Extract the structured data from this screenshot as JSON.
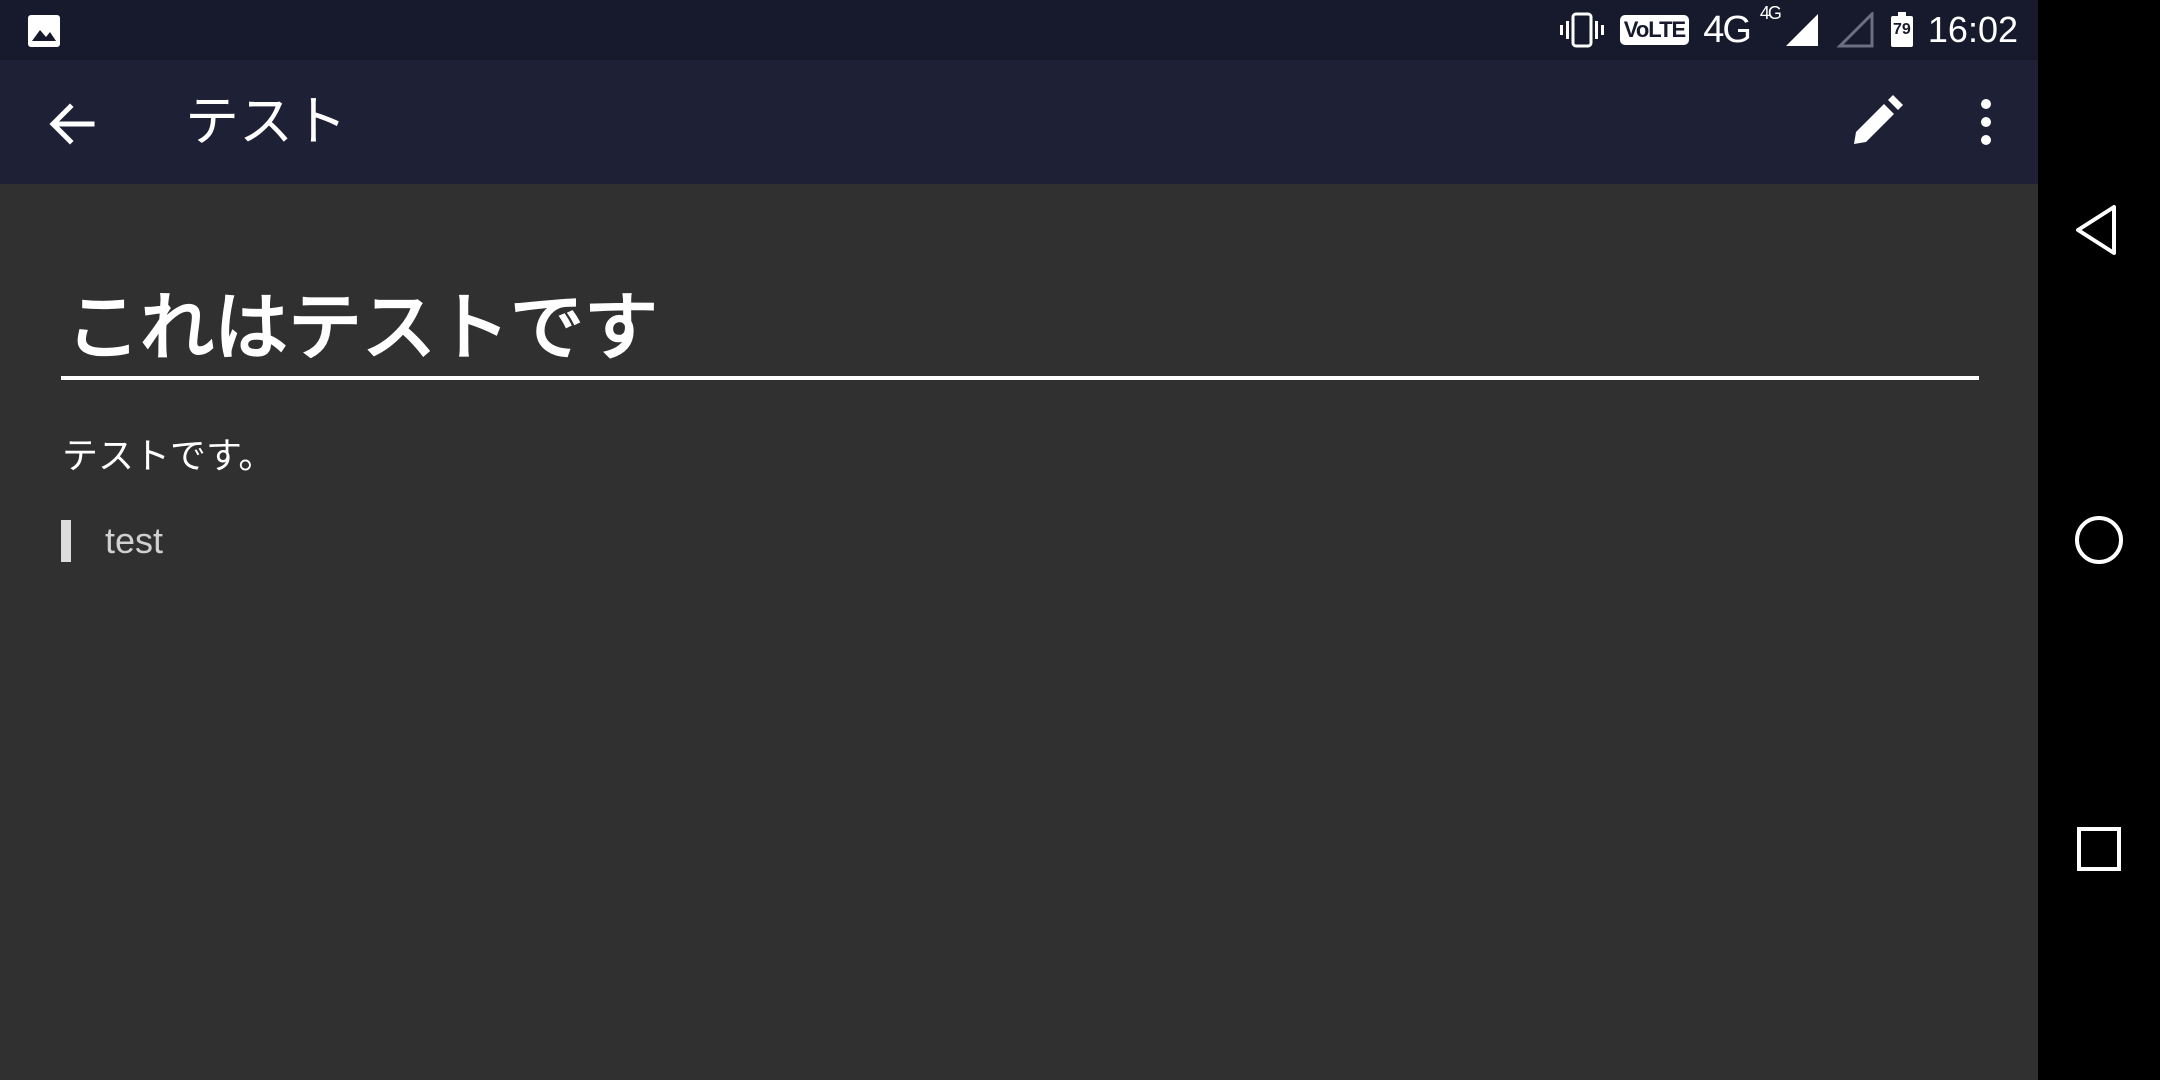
{
  "status_bar": {
    "left_icons": [
      "gallery-icon"
    ],
    "right_icons": [
      "vibrate-icon",
      "volte-icon",
      "signal-4g-icon",
      "signal-empty-icon",
      "battery-icon"
    ],
    "volte": "VoLTE",
    "network": "4G",
    "network_sup": "4G",
    "battery_level": "79",
    "time": "16:02"
  },
  "toolbar": {
    "title": "テスト",
    "icons": [
      "back-arrow-icon",
      "edit-pencil-icon",
      "more-vert-icon"
    ]
  },
  "content": {
    "heading": "これはテストです",
    "paragraph": "テストです。",
    "blockquote": "test"
  },
  "nav_bar": {
    "icons": [
      "nav-back-icon",
      "nav-home-icon",
      "nav-recents-icon"
    ]
  },
  "colors": {
    "status_bar_bg": "#161a2c",
    "toolbar_bg": "#1e2036",
    "content_bg": "#303030",
    "nav_bar_bg": "#000000",
    "text": "#ffffff"
  }
}
